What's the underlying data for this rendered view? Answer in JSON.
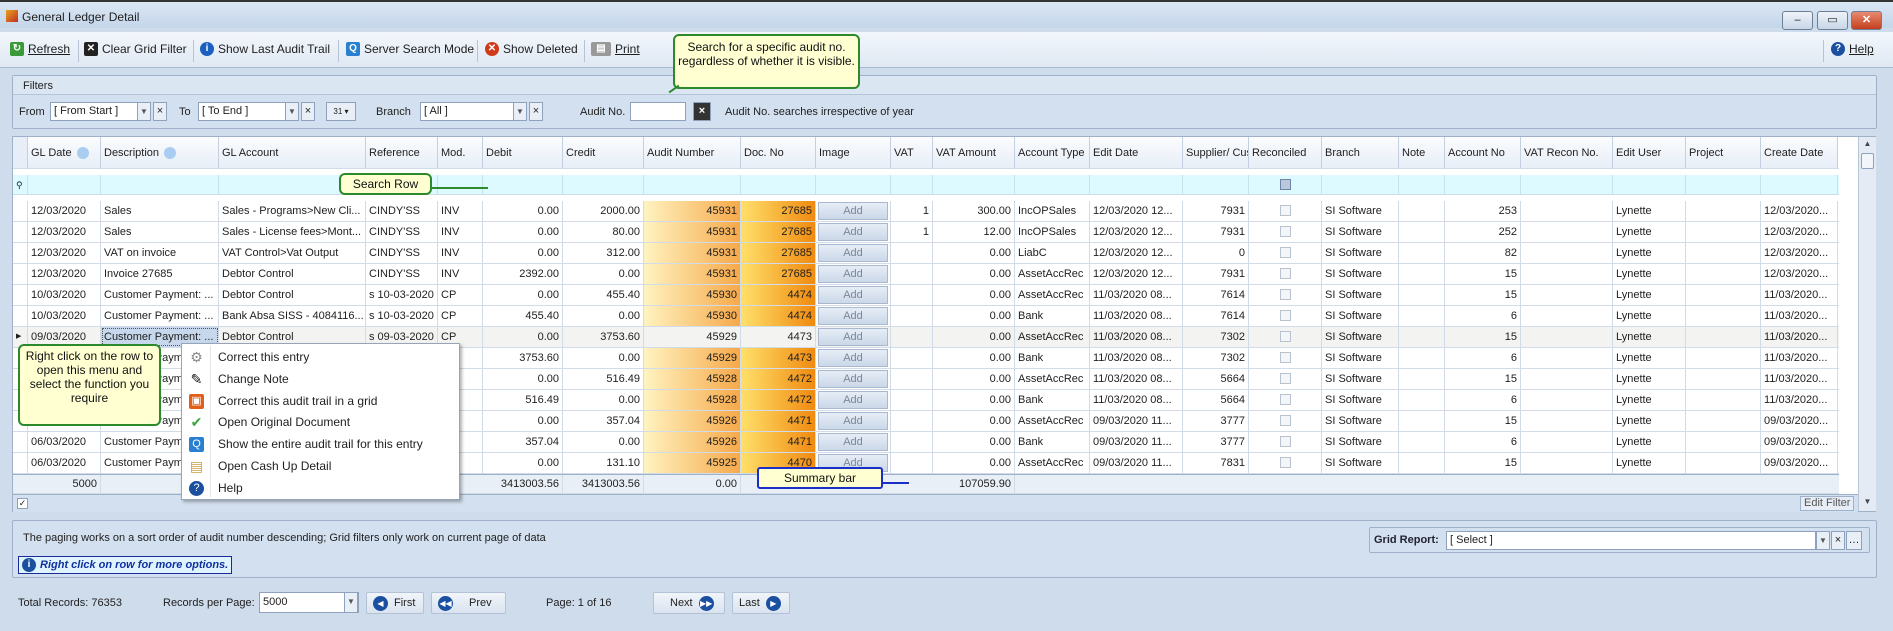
{
  "window": {
    "title": "General Ledger Detail",
    "minimize": "‒",
    "maximize": "▭",
    "close": "✕"
  },
  "toolbar": {
    "refresh": "Refresh",
    "clear_grid_filter": "Clear Grid Filter",
    "show_last_audit_trail": "Show Last Audit Trail",
    "server_search_mode": "Server Search Mode",
    "show_deleted": "Show Deleted",
    "print": "Print",
    "help": "Help"
  },
  "filters": {
    "group_label": "Filters",
    "from_label": "From",
    "from_value": "[ From Start ]",
    "to_label": "To",
    "to_value": "[ To End ]",
    "calendar": "31",
    "branch_label": "Branch",
    "branch_value": "[ All ]",
    "audit_label": "Audit No.",
    "audit_value": "",
    "audit_note": "Audit No. searches irrespective of year"
  },
  "callouts": {
    "search": "Search for a specific audit no. regardless of whether it is visible.",
    "search_row": "Search Row",
    "right_click": "Right click on the row to open this menu and select the function you require",
    "summary_bar": "Summary bar"
  },
  "grid": {
    "columns": [
      "GL Date",
      "Description",
      "GL Account",
      "Reference",
      "Mod.",
      "Debit",
      "Credit",
      "Audit Number",
      "Doc. No",
      "Image",
      "VAT",
      "VAT Amount",
      "Account Type",
      "Edit Date",
      "Supplier/ Cust.No.",
      "Reconciled",
      "Branch",
      "Note",
      "Account No",
      "VAT Recon No.",
      "Edit User",
      "Project",
      "Create Date"
    ],
    "rows": [
      [
        "12/03/2020",
        "Sales",
        "Sales - Programs>New Cli...",
        "CINDY'SS",
        "INV",
        "0.00",
        "2000.00",
        "45931",
        "27685",
        "Add",
        "1",
        "300.00",
        "IncOPSales",
        "12/03/2020 12...",
        "7931",
        "",
        "SI Software",
        "",
        "253",
        "",
        "Lynette",
        "",
        "12/03/2020..."
      ],
      [
        "12/03/2020",
        "Sales",
        "Sales - License fees>Mont...",
        "CINDY'SS",
        "INV",
        "0.00",
        "80.00",
        "45931",
        "27685",
        "Add",
        "1",
        "12.00",
        "IncOPSales",
        "12/03/2020 12...",
        "7931",
        "",
        "SI Software",
        "",
        "252",
        "",
        "Lynette",
        "",
        "12/03/2020..."
      ],
      [
        "12/03/2020",
        "VAT on invoice",
        "VAT Control>Vat Output",
        "CINDY'SS",
        "INV",
        "0.00",
        "312.00",
        "45931",
        "27685",
        "Add",
        "",
        "0.00",
        "LiabC",
        "12/03/2020 12...",
        "0",
        "",
        "SI Software",
        "",
        "82",
        "",
        "Lynette",
        "",
        "12/03/2020..."
      ],
      [
        "12/03/2020",
        "Invoice 27685",
        "Debtor Control",
        "CINDY'SS",
        "INV",
        "2392.00",
        "0.00",
        "45931",
        "27685",
        "Add",
        "",
        "0.00",
        "AssetAccRec",
        "12/03/2020 12...",
        "7931",
        "",
        "SI Software",
        "",
        "15",
        "",
        "Lynette",
        "",
        "12/03/2020..."
      ],
      [
        "10/03/2020",
        "Customer Payment: ...",
        "Debtor Control",
        "s 10-03-2020",
        "CP",
        "0.00",
        "455.40",
        "45930",
        "4474",
        "Add",
        "",
        "0.00",
        "AssetAccRec",
        "11/03/2020 08...",
        "7614",
        "",
        "SI Software",
        "",
        "15",
        "",
        "Lynette",
        "",
        "11/03/2020..."
      ],
      [
        "10/03/2020",
        "Customer Payment: ...",
        "Bank Absa SISS - 4084116...",
        "s 10-03-2020",
        "CP",
        "455.40",
        "0.00",
        "45930",
        "4474",
        "Add",
        "",
        "0.00",
        "Bank",
        "11/03/2020 08...",
        "7614",
        "",
        "SI Software",
        "",
        "6",
        "",
        "Lynette",
        "",
        "11/03/2020..."
      ],
      [
        "09/03/2020",
        "Customer Payment: ...",
        "Debtor Control",
        "s 09-03-2020",
        "CP",
        "0.00",
        "3753.60",
        "45929",
        "4473",
        "Add",
        "",
        "0.00",
        "AssetAccRec",
        "11/03/2020 08...",
        "7302",
        "",
        "SI Software",
        "",
        "15",
        "",
        "Lynette",
        "",
        "11/03/2020..."
      ],
      [
        "",
        "Customer Paym",
        "",
        "",
        "",
        "3753.60",
        "0.00",
        "45929",
        "4473",
        "Add",
        "",
        "0.00",
        "Bank",
        "11/03/2020 08...",
        "7302",
        "",
        "SI Software",
        "",
        "6",
        "",
        "Lynette",
        "",
        "11/03/2020..."
      ],
      [
        "",
        "Customer Paym",
        "",
        "",
        "",
        "0.00",
        "516.49",
        "45928",
        "4472",
        "Add",
        "",
        "0.00",
        "AssetAccRec",
        "11/03/2020 08...",
        "5664",
        "",
        "SI Software",
        "",
        "15",
        "",
        "Lynette",
        "",
        "11/03/2020..."
      ],
      [
        "",
        "Customer Paym",
        "",
        "",
        "",
        "516.49",
        "0.00",
        "45928",
        "4472",
        "Add",
        "",
        "0.00",
        "Bank",
        "11/03/2020 08...",
        "5664",
        "",
        "SI Software",
        "",
        "6",
        "",
        "Lynette",
        "",
        "11/03/2020..."
      ],
      [
        "",
        "Customer Paym",
        "",
        "",
        "",
        "0.00",
        "357.04",
        "45926",
        "4471",
        "Add",
        "",
        "0.00",
        "AssetAccRec",
        "09/03/2020 11...",
        "3777",
        "",
        "SI Software",
        "",
        "15",
        "",
        "Lynette",
        "",
        "09/03/2020..."
      ],
      [
        "06/03/2020",
        "Customer Paym",
        "",
        "",
        "",
        "357.04",
        "0.00",
        "45926",
        "4471",
        "Add",
        "",
        "0.00",
        "Bank",
        "09/03/2020 11...",
        "3777",
        "",
        "SI Software",
        "",
        "6",
        "",
        "Lynette",
        "",
        "09/03/2020..."
      ],
      [
        "06/03/2020",
        "Customer Paym",
        "",
        "",
        "",
        "0.00",
        "131.10",
        "45925",
        "4470",
        "Add",
        "",
        "0.00",
        "AssetAccRec",
        "09/03/2020 11...",
        "7831",
        "",
        "SI Software",
        "",
        "15",
        "",
        "Lynette",
        "",
        "09/03/2020..."
      ]
    ],
    "selected_row": 6,
    "summary": {
      "count": "5000",
      "debit": "3413003.56",
      "credit": "3413003.56",
      "audit": "0.00",
      "vat_amount": "107059.90"
    },
    "edit_filter": "Edit Filter"
  },
  "context_menu": [
    {
      "label": "Correct this entry",
      "icon": "gear-icon"
    },
    {
      "label": "Change Note",
      "icon": "pen-icon"
    },
    {
      "label": "Correct this audit trail in a grid",
      "icon": "grid-icon"
    },
    {
      "label": "Open Original Document",
      "icon": "check-icon"
    },
    {
      "label": "Show the entire audit trail for this entry",
      "icon": "search-icon"
    },
    {
      "label": "Open Cash Up Detail",
      "icon": "cashbox-icon"
    },
    {
      "label": "Help",
      "icon": "help-icon"
    }
  ],
  "info": {
    "paging_note": "The paging works on a sort order of audit number descending; Grid filters only work on current page of data",
    "right_click_hint": "Right click on row for more options.",
    "grid_report_label": "Grid Report:",
    "grid_report_value": "[ Select ]"
  },
  "paging": {
    "total_records": "Total Records: 76353",
    "records_per_page_label": "Records per Page:",
    "records_per_page": "5000",
    "first": "First",
    "prev": "Prev",
    "page": "Page: 1 of 16",
    "next": "Next",
    "last": "Last"
  },
  "colors": {
    "accent": "#1b4fa0",
    "audit_gradient_end": "#f6a94a",
    "doc_gradient_end": "#f08a10",
    "callout_border": "#2c8a2c"
  }
}
